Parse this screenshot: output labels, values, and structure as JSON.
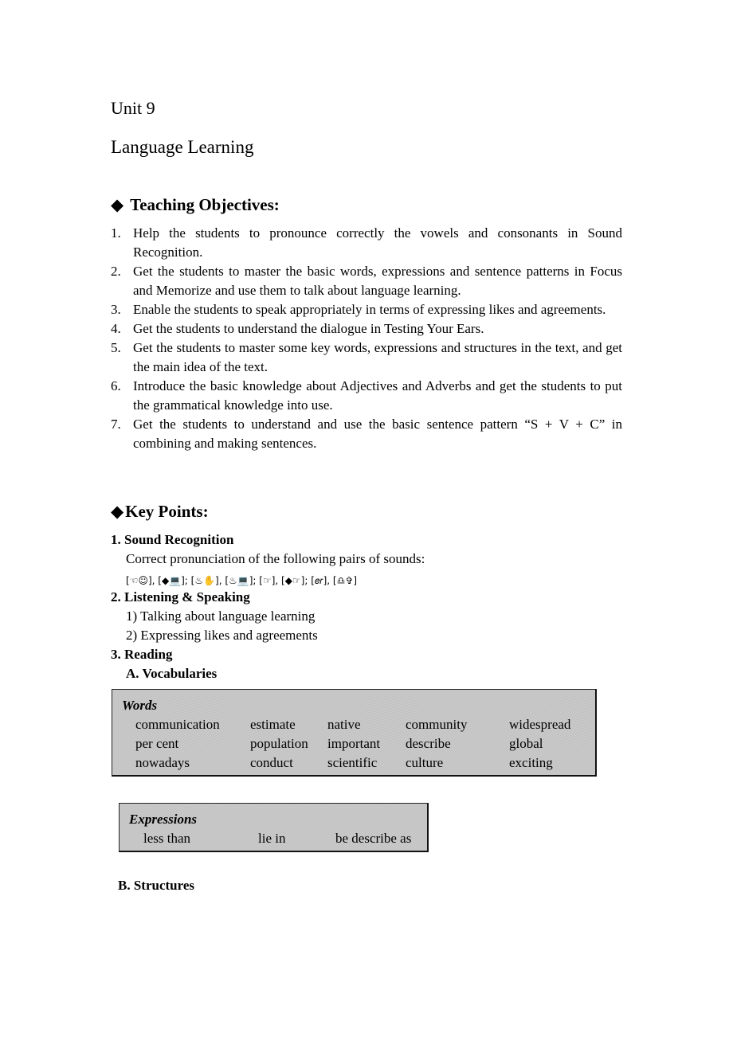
{
  "header": {
    "unit": "Unit 9",
    "title": "Language Learning"
  },
  "objectives": {
    "bullet_icon": "◆",
    "heading": "Teaching Objectives:",
    "items": [
      {
        "num": "1.",
        "text": "Help the students to pronounce correctly the vowels and consonants in Sound Recognition."
      },
      {
        "num": "2.",
        "text": "Get the students to master the basic words, expressions and sentence patterns in Focus and Memorize and use them to talk about language learning."
      },
      {
        "num": "3.",
        "text": "Enable the students to speak appropriately in terms of expressing likes and agreements."
      },
      {
        "num": "4.",
        "text": "Get the students to understand the dialogue in Testing Your Ears."
      },
      {
        "num": "5.",
        "text": "Get the students to master some key words, expressions and structures in the text, and get the main idea of the text."
      },
      {
        "num": "6.",
        "text": "Introduce the basic knowledge about Adjectives and Adverbs and get the students to put the grammatical knowledge into use."
      },
      {
        "num": "7.",
        "text": "Get the students to understand and use the basic sentence pattern “S + V + C” in combining and making sentences."
      }
    ]
  },
  "key_points": {
    "bullet_icon": "◆",
    "heading": "Key Points:",
    "sound": {
      "heading": "1. Sound Recognition",
      "intro": "Correct pronunciation of the following pairs of sounds:",
      "symbols": "[☜☺], [◆💻]; [♨✋], [♨💻]; [☞], [◆☞]; [𝑒𝑟], [♎✞]"
    },
    "listening": {
      "heading": "2. Listening & Speaking",
      "items": [
        "1) Talking about language learning",
        "2) Expressing likes and agreements"
      ]
    },
    "reading": {
      "heading": "3. Reading",
      "vocab_heading": "A. Vocabularies",
      "words_box": {
        "title": "Words",
        "rows": [
          [
            "communication",
            "estimate",
            "native",
            "community",
            "widespread"
          ],
          [
            "per cent",
            "population",
            "important",
            "describe",
            "global"
          ],
          [
            "nowadays",
            "conduct",
            "scientific",
            "culture",
            "exciting"
          ]
        ]
      },
      "expressions_box": {
        "title": "Expressions",
        "items": [
          "less than",
          "lie in",
          "be describe as"
        ]
      },
      "structures_heading": "B. Structures"
    }
  }
}
